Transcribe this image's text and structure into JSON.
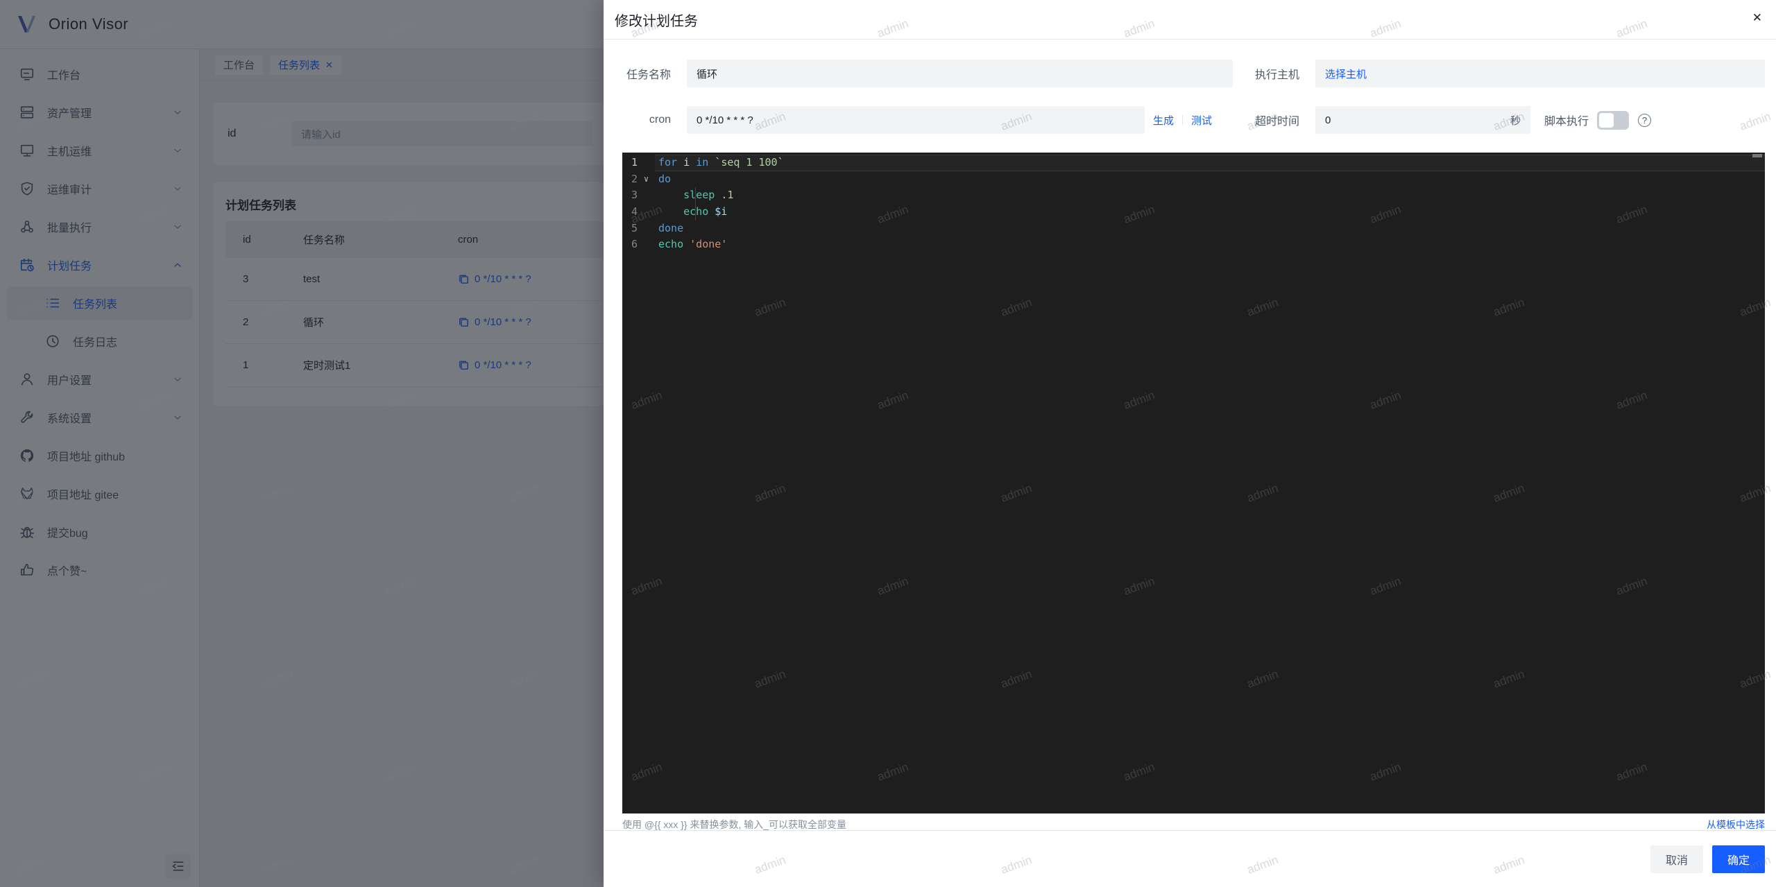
{
  "app": {
    "logo_text": "Orion Visor"
  },
  "colors": {
    "accent": "#165dff",
    "mask": "rgba(29,33,41,0.6)",
    "editor_bg": "#1e1e1e",
    "switch_off": "#c9cdd4",
    "code_keyword": "#569cd6",
    "code_command": "#b5cea8",
    "code_builtin": "#4ec9b0",
    "code_number": "#b5cea8",
    "code_variable": "#9cdcfe",
    "code_string": "#ce9178"
  },
  "watermark": {
    "text": "admin"
  },
  "sidebar": {
    "items": [
      {
        "key": "workbench",
        "label": "工作台",
        "icon": "workbench-icon",
        "chevron": "",
        "sub": false,
        "active": false,
        "selbg": false
      },
      {
        "key": "assets",
        "label": "资产管理",
        "icon": "assets-icon",
        "chevron": "down",
        "sub": false,
        "active": false,
        "selbg": false
      },
      {
        "key": "host-ops",
        "label": "主机运维",
        "icon": "host-icon",
        "chevron": "down",
        "sub": false,
        "active": false,
        "selbg": false
      },
      {
        "key": "audit",
        "label": "运维审计",
        "icon": "audit-icon",
        "chevron": "down",
        "sub": false,
        "active": false,
        "selbg": false
      },
      {
        "key": "batch-exec",
        "label": "批量执行",
        "icon": "batch-icon",
        "chevron": "down",
        "sub": false,
        "active": false,
        "selbg": false
      },
      {
        "key": "schedule",
        "label": "计划任务",
        "icon": "schedule-icon",
        "chevron": "up",
        "sub": false,
        "active": true,
        "selbg": false
      },
      {
        "key": "task-list",
        "label": "任务列表",
        "icon": "list-icon",
        "chevron": "",
        "sub": true,
        "active": true,
        "selbg": true
      },
      {
        "key": "task-log",
        "label": "任务日志",
        "icon": "history-icon",
        "chevron": "",
        "sub": true,
        "active": false,
        "selbg": false
      },
      {
        "key": "user-settings",
        "label": "用户设置",
        "icon": "user-icon",
        "chevron": "down",
        "sub": false,
        "active": false,
        "selbg": false
      },
      {
        "key": "system-settings",
        "label": "系统设置",
        "icon": "wrench-icon",
        "chevron": "down",
        "sub": false,
        "active": false,
        "selbg": false
      },
      {
        "key": "github",
        "label": "项目地址 github",
        "icon": "github-icon",
        "chevron": "",
        "sub": false,
        "active": false,
        "selbg": false
      },
      {
        "key": "gitee",
        "label": "项目地址 gitee",
        "icon": "gitee-icon",
        "chevron": "",
        "sub": false,
        "active": false,
        "selbg": false
      },
      {
        "key": "bug",
        "label": "提交bug",
        "icon": "bug-icon",
        "chevron": "",
        "sub": false,
        "active": false,
        "selbg": false
      },
      {
        "key": "like",
        "label": "点个赞~",
        "icon": "thumbs-up-icon",
        "chevron": "",
        "sub": false,
        "active": false,
        "selbg": false
      }
    ]
  },
  "tabs": [
    {
      "key": "workbench",
      "label": "工作台",
      "active": false,
      "closable": false
    },
    {
      "key": "task-list",
      "label": "任务列表",
      "active": true,
      "closable": true,
      "close_glyph": "✕"
    }
  ],
  "filter": {
    "id_label": "id",
    "id_placeholder": "请输入id"
  },
  "task_table": {
    "title": "计划任务列表",
    "columns": [
      "id",
      "任务名称",
      "cron"
    ],
    "rows": [
      {
        "id": "3",
        "name": "test",
        "cron": "0 */10 * * * ?"
      },
      {
        "id": "2",
        "name": "循环",
        "cron": "0 */10 * * * ?"
      },
      {
        "id": "1",
        "name": "定时测试1",
        "cron": "0 */10 * * * ?"
      }
    ]
  },
  "drawer": {
    "title": "修改计划任务",
    "close_glyph": "✕",
    "fields": {
      "name_label": "任务名称",
      "name_value": "循环",
      "host_label": "执行主机",
      "host_link": "选择主机",
      "cron_label": "cron",
      "cron_value": "0 */10 * * * ?",
      "generate_link": "生成",
      "test_link": "测试",
      "timeout_label": "超时时间",
      "timeout_value": "0",
      "timeout_unit": "秒",
      "script_label": "脚本执行",
      "help_glyph": "?"
    },
    "editor_lines": [
      {
        "num": "1",
        "cur": true,
        "fold": "",
        "guide": false,
        "tokens": [
          {
            "t": "for",
            "c": "kw"
          },
          {
            "t": " i ",
            "c": "pl"
          },
          {
            "t": "in",
            "c": "kw"
          },
          {
            "t": " ",
            "c": "pl"
          },
          {
            "t": "`",
            "c": "punc"
          },
          {
            "t": "seq 1 100",
            "c": "cmd"
          },
          {
            "t": "`",
            "c": "punc"
          }
        ]
      },
      {
        "num": "2",
        "cur": false,
        "fold": "∨",
        "guide": false,
        "tokens": [
          {
            "t": "do",
            "c": "kw"
          }
        ]
      },
      {
        "num": "3",
        "cur": false,
        "fold": "",
        "guide": true,
        "tokens": [
          {
            "t": "    ",
            "c": "pl"
          },
          {
            "t": "sleep",
            "c": "bi"
          },
          {
            "t": " ",
            "c": "pl"
          },
          {
            "t": ".1",
            "c": "num"
          }
        ]
      },
      {
        "num": "4",
        "cur": false,
        "fold": "",
        "guide": true,
        "tokens": [
          {
            "t": "    ",
            "c": "pl"
          },
          {
            "t": "echo",
            "c": "bi"
          },
          {
            "t": " ",
            "c": "pl"
          },
          {
            "t": "$i",
            "c": "var"
          }
        ]
      },
      {
        "num": "5",
        "cur": false,
        "fold": "",
        "guide": false,
        "tokens": [
          {
            "t": "done",
            "c": "kw"
          }
        ]
      },
      {
        "num": "6",
        "cur": false,
        "fold": "",
        "guide": false,
        "tokens": [
          {
            "t": "echo",
            "c": "bi"
          },
          {
            "t": " ",
            "c": "pl"
          },
          {
            "t": "'done'",
            "c": "str"
          }
        ]
      }
    ],
    "hint": "使用 @{{ xxx }} 来替换参数, 输入_可以获取全部变量",
    "template_link": "从模板中选择",
    "footer": {
      "cancel": "取消",
      "confirm": "确定"
    }
  }
}
